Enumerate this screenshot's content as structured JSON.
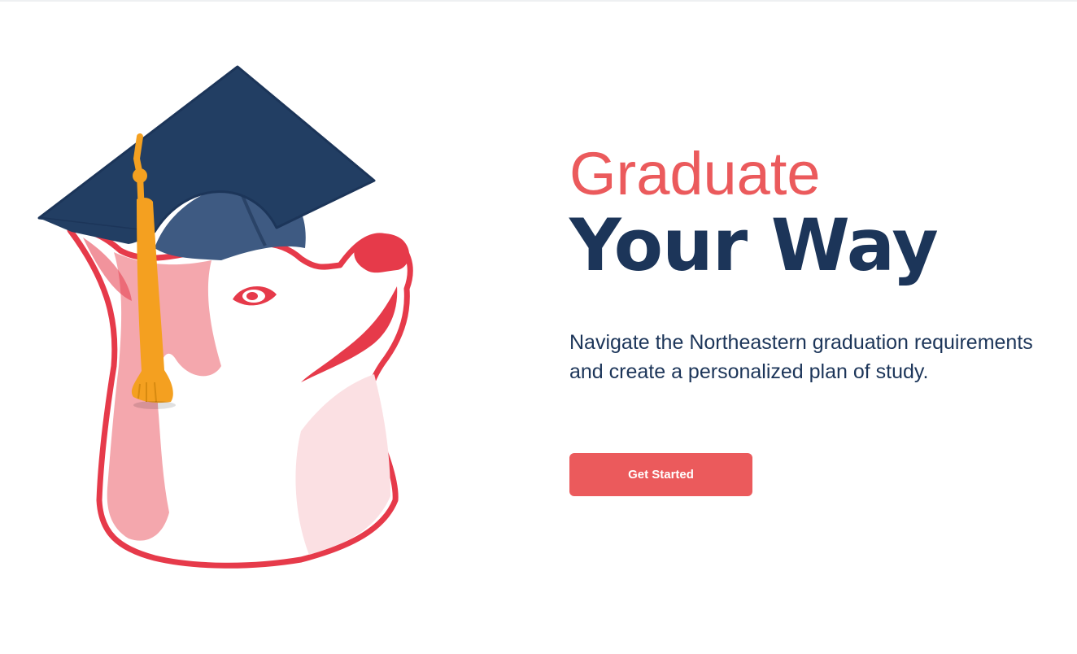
{
  "hero": {
    "title_top": "Graduate",
    "title_main": "Your Way",
    "description": "Navigate the Northeastern graduation requirements and create a personalized plan of study.",
    "cta_label": "Get Started"
  },
  "mascot": {
    "icon": "husky-graduation-cap-icon"
  },
  "colors": {
    "accent": "#eb5a5c",
    "navy": "#1c3559",
    "dog_outline": "#e63a4a",
    "dog_pink": "#f4a7ad",
    "tassel": "#f4a020"
  }
}
